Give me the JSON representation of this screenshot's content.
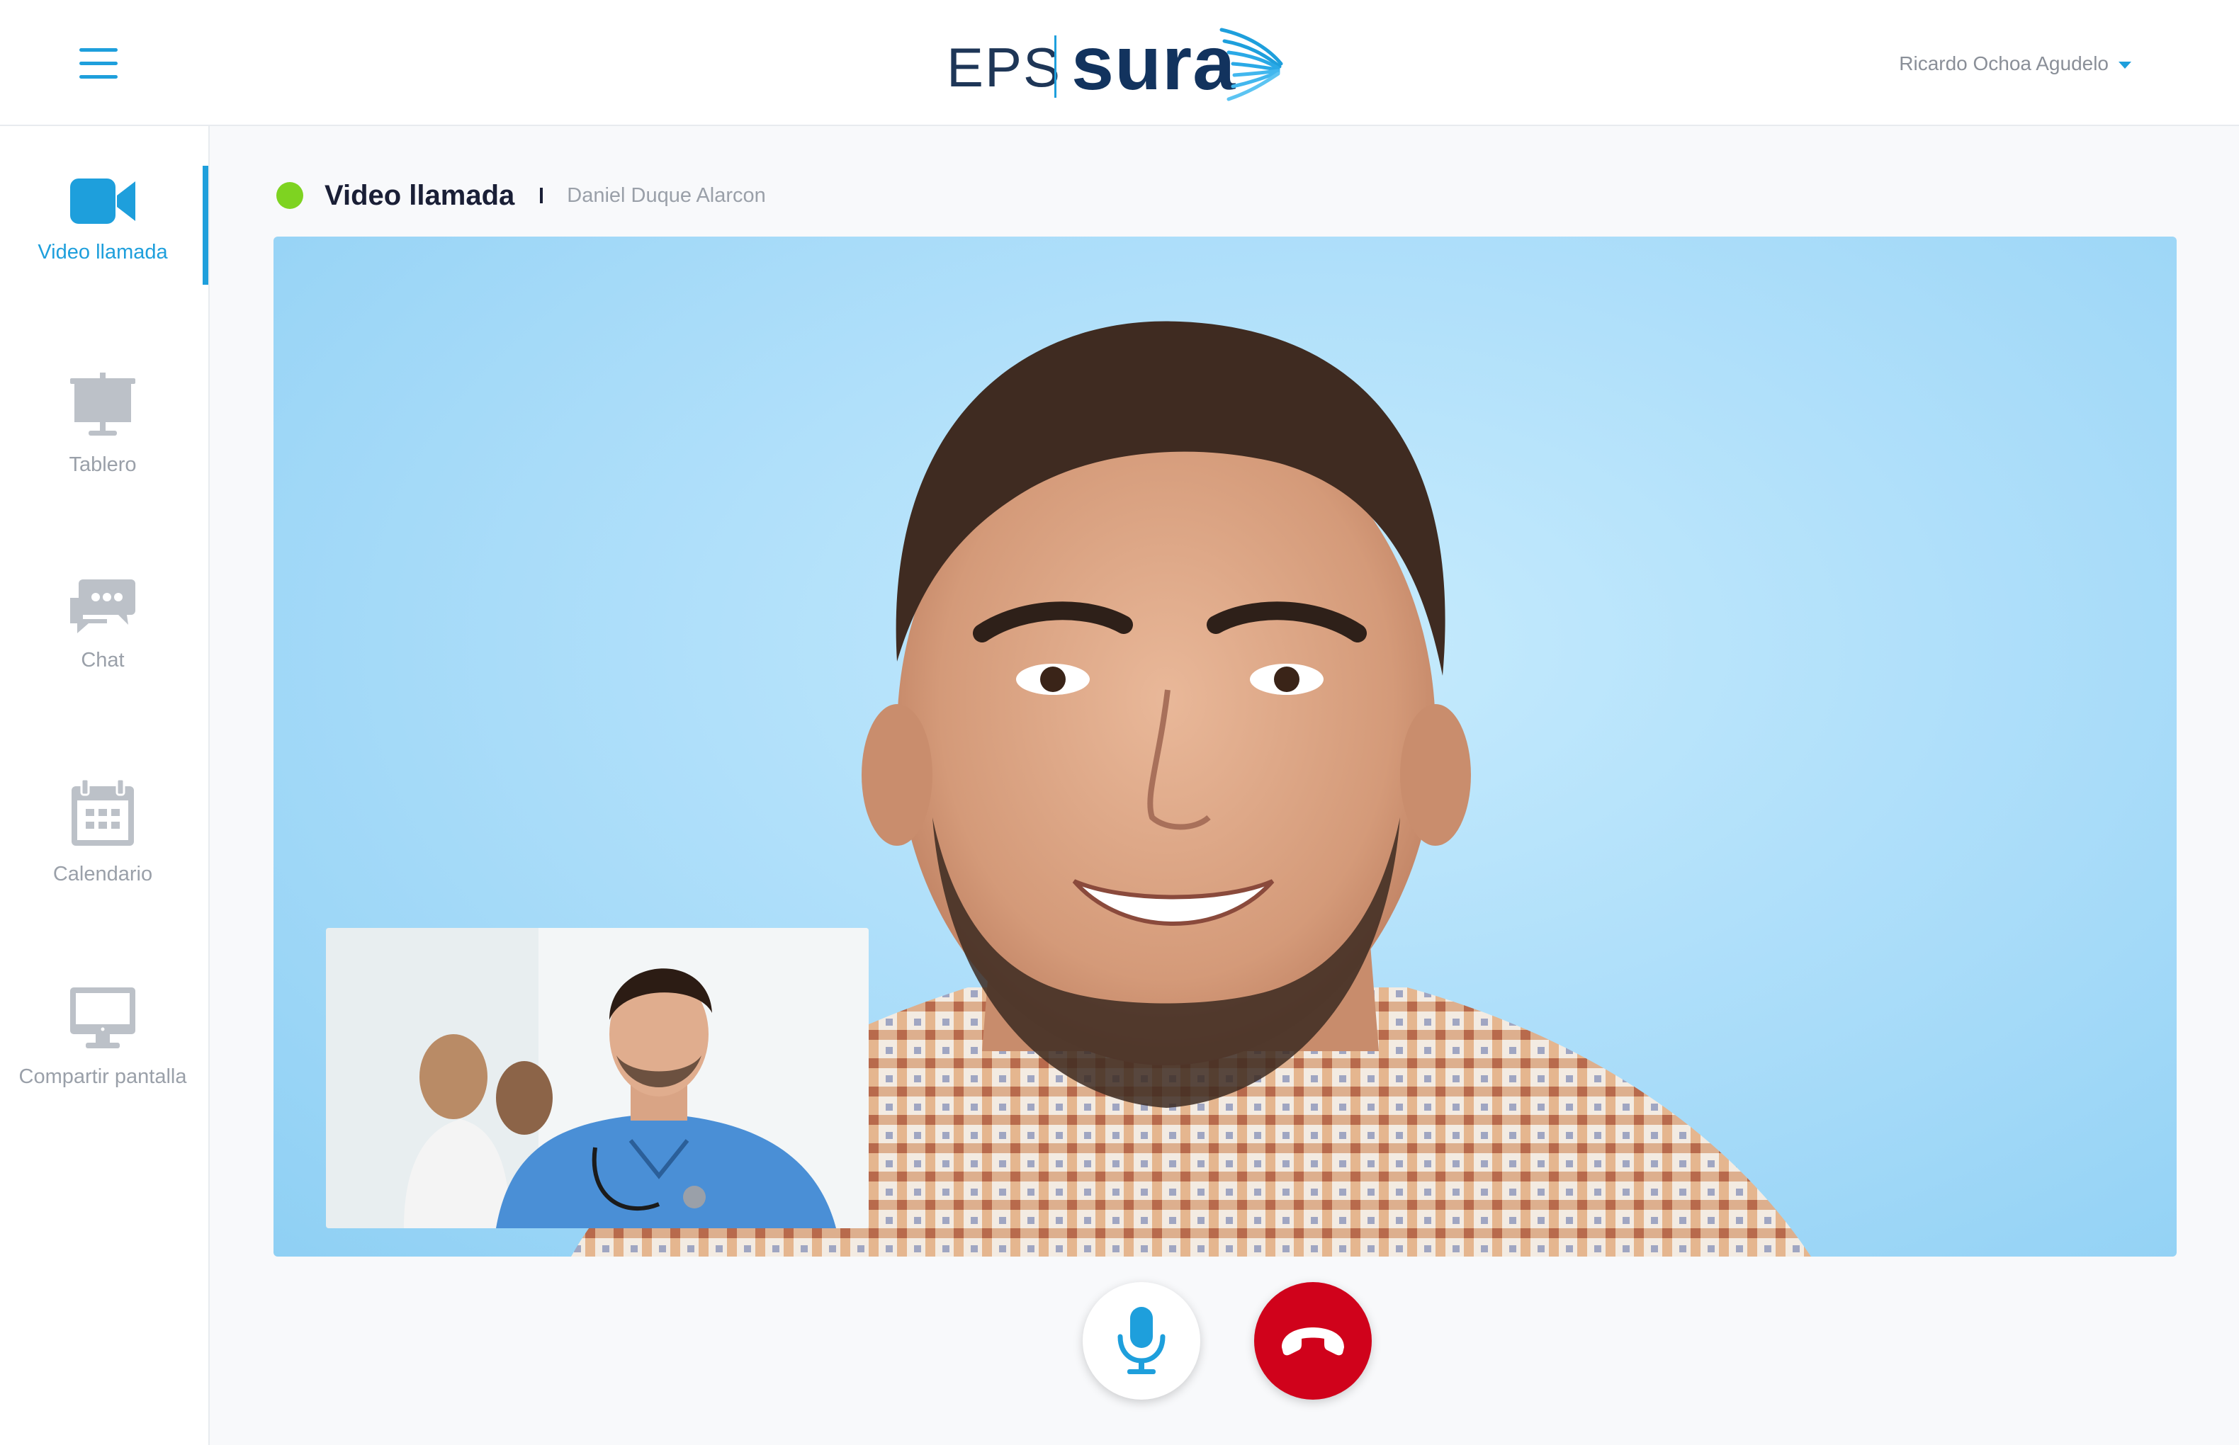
{
  "header": {
    "logo_eps": "EPS",
    "logo_sura": "sura",
    "user_name": "Ricardo Ochoa Agudelo",
    "menu_icon": "hamburger-menu-icon",
    "user_menu_icon": "chevron-down-icon"
  },
  "sidebar": {
    "items": [
      {
        "label": "Video llamada",
        "icon": "video-camera-icon",
        "active": true
      },
      {
        "label": "Tablero",
        "icon": "presentation-board-icon",
        "active": false
      },
      {
        "label": "Chat",
        "icon": "chat-bubbles-icon",
        "active": false
      },
      {
        "label": "Calendario",
        "icon": "calendar-icon",
        "active": false
      },
      {
        "label": "Compartir pantalla",
        "icon": "monitor-icon",
        "active": false
      }
    ]
  },
  "main": {
    "title": "Video llamada",
    "patient_name": "Daniel Duque Alarcon",
    "status": "online"
  },
  "controls": {
    "mic_icon": "microphone-icon",
    "hangup_icon": "hang-up-phone-icon"
  },
  "colors": {
    "accent": "#1e9fdc",
    "status_online": "#7ed321",
    "hangup": "#d0021b",
    "inactive": "#bcc1c8"
  }
}
